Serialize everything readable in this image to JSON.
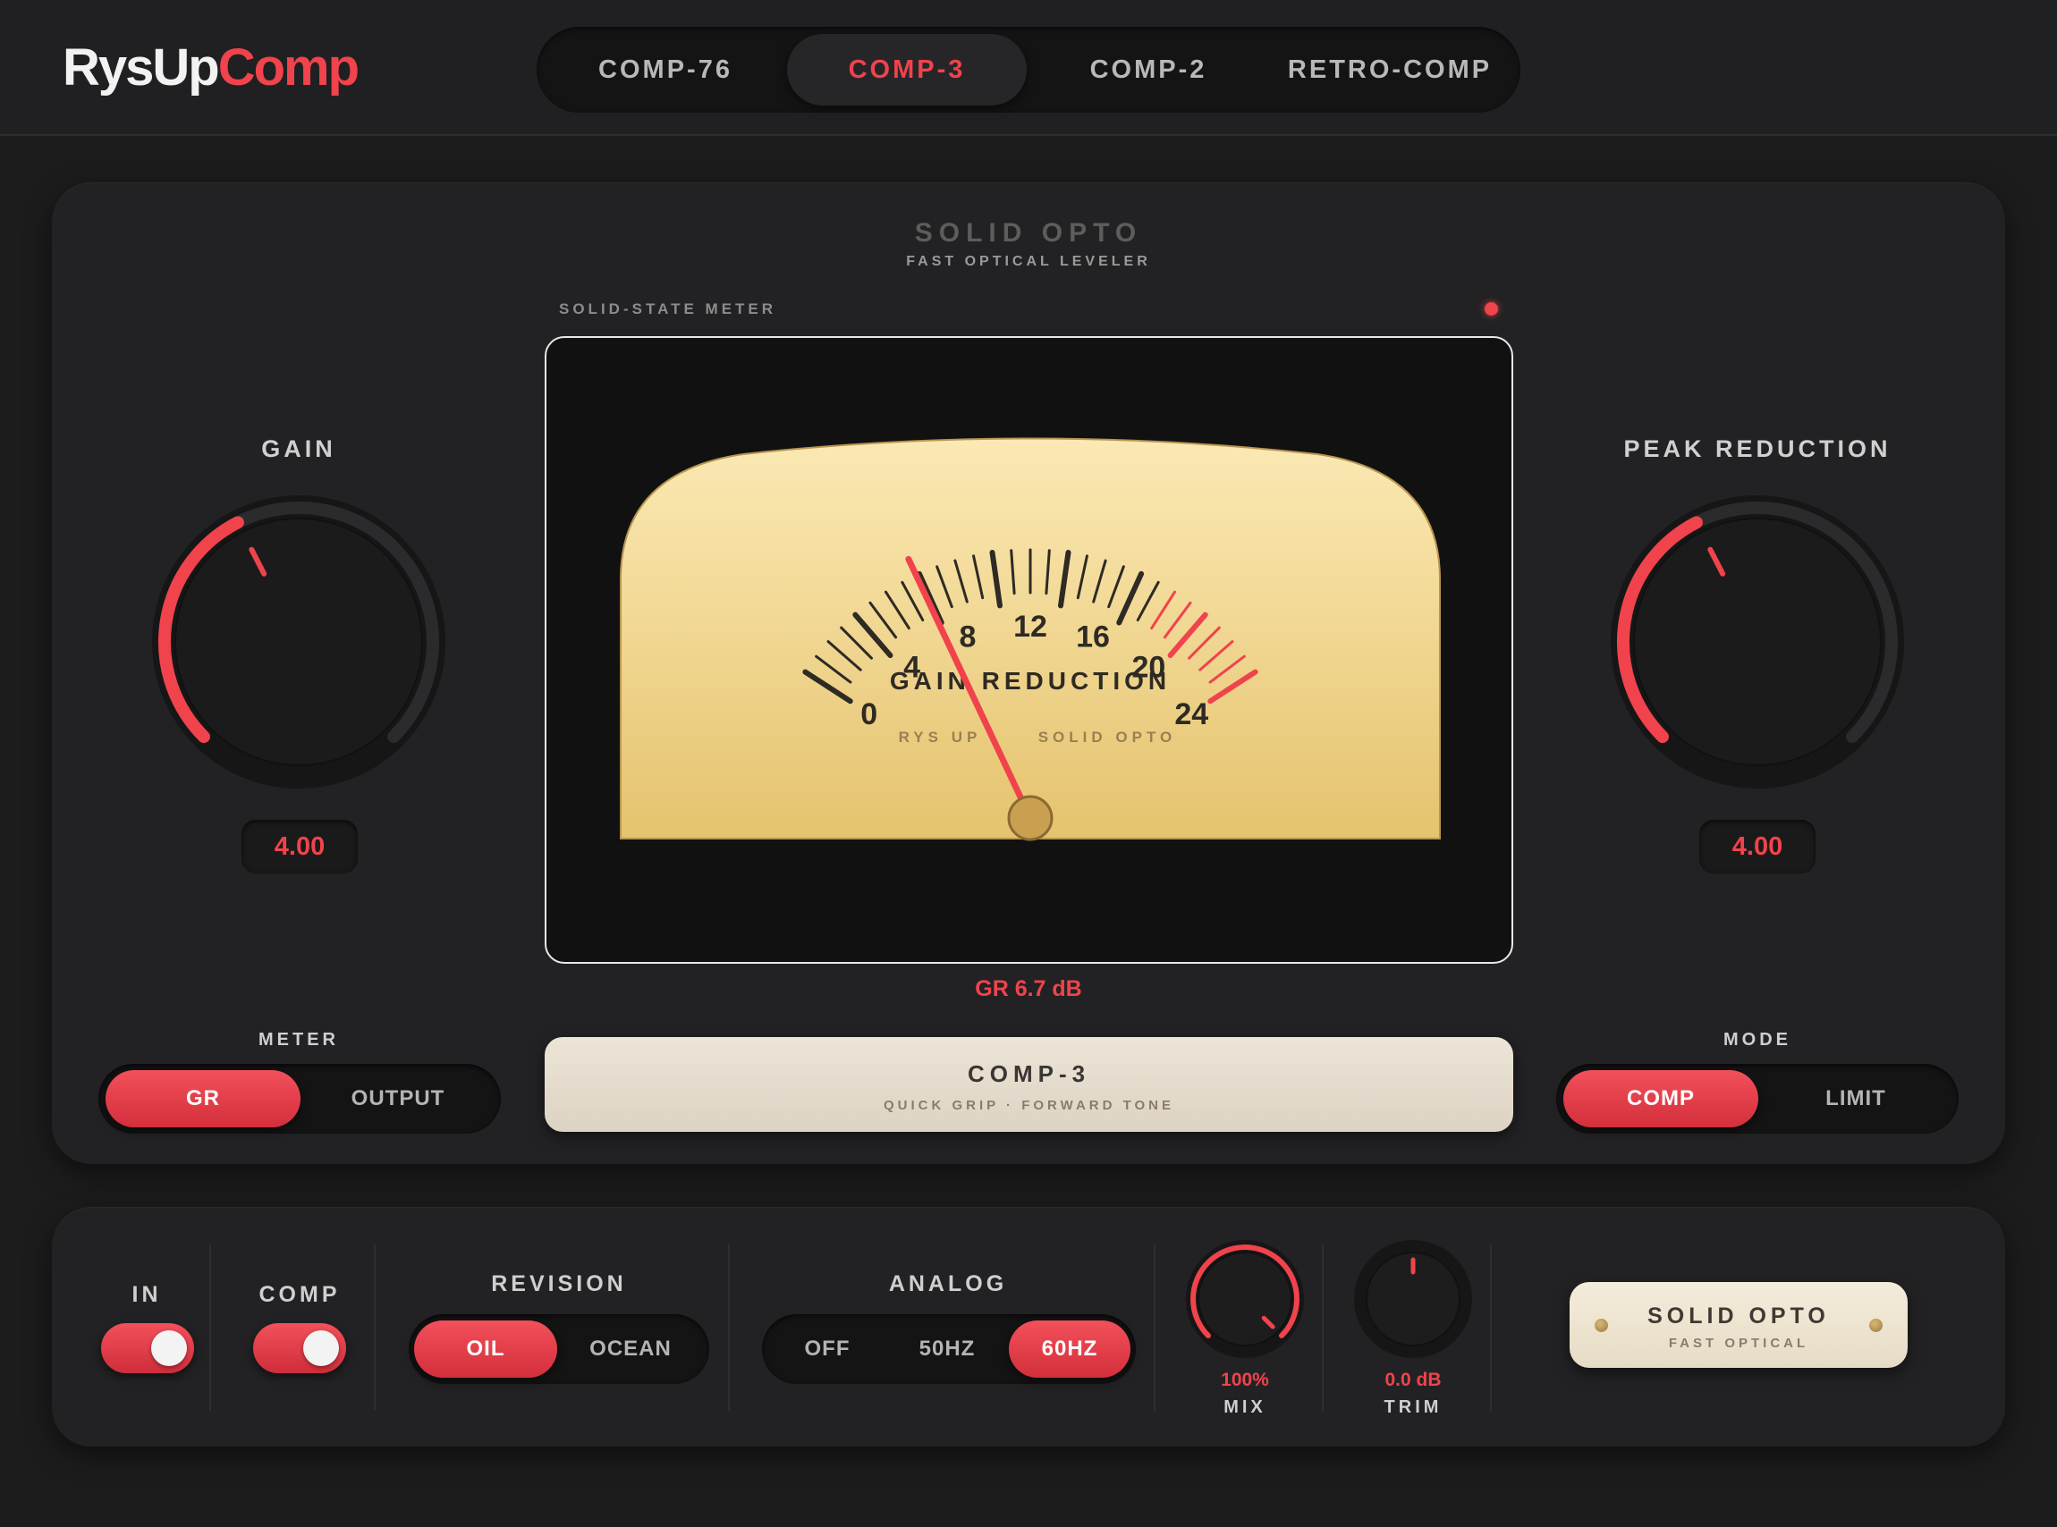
{
  "brand": {
    "part1": "RysUp",
    "part2": "Comp"
  },
  "tabs": [
    {
      "label": "COMP-76",
      "active": false
    },
    {
      "label": "COMP-3",
      "active": true
    },
    {
      "label": "COMP-2",
      "active": false
    },
    {
      "label": "RETRO-COMP",
      "active": false
    }
  ],
  "model": {
    "title": "SOLID OPTO",
    "subtitle": "FAST OPTICAL LEVELER"
  },
  "meter": {
    "label": "SOLID-STATE METER",
    "scale_labels": [
      "0",
      "4",
      "8",
      "12",
      "16",
      "20",
      "24"
    ],
    "scale_title": "GAIN REDUCTION",
    "maker_left": "RYS UP",
    "maker_right": "SOLID OPTO",
    "readout": "GR 6.7 dB",
    "needle_value": 6.7,
    "scale_max": 24
  },
  "gain": {
    "title": "GAIN",
    "value": "4.00",
    "level": 0.4
  },
  "peak_reduction": {
    "title": "PEAK REDUCTION",
    "value": "4.00",
    "level": 0.4
  },
  "meter_select": {
    "title": "METER",
    "options": [
      "GR",
      "OUTPUT"
    ],
    "selected": "GR"
  },
  "mode_select": {
    "title": "MODE",
    "options": [
      "COMP",
      "LIMIT"
    ],
    "selected": "COMP"
  },
  "nameplate": {
    "title": "COMP-3",
    "subtitle": "QUICK GRIP · FORWARD TONE"
  },
  "bottom": {
    "in_label": "IN",
    "comp_label": "COMP",
    "revision": {
      "title": "REVISION",
      "options": [
        "OIL",
        "OCEAN"
      ],
      "selected": "OIL"
    },
    "analog": {
      "title": "ANALOG",
      "options": [
        "OFF",
        "50HZ",
        "60HZ"
      ],
      "selected": "60HZ"
    },
    "mix": {
      "label": "MIX",
      "value": "100%",
      "level": 1.0
    },
    "trim": {
      "label": "TRIM",
      "value": "0.0 dB",
      "level": 0.5
    },
    "badge": {
      "title": "SOLID OPTO",
      "subtitle": "FAST OPTICAL"
    }
  },
  "colors": {
    "accent": "#f0434c",
    "panel": "#222224",
    "meter_face": "#f5dfa0"
  }
}
